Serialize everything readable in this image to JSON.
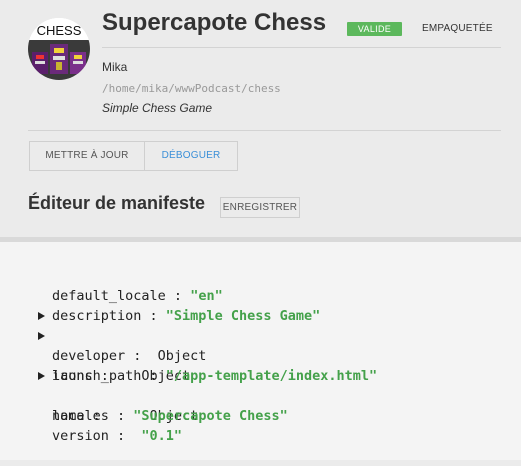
{
  "app": {
    "title": "Supercapote Chess",
    "status_valid": "VALIDE",
    "status_packaged": "EMPAQUETÉE",
    "author": "Mika",
    "path": "/home/mika/wwwPodcast/chess",
    "description": "Simple Chess Game",
    "icon_text": "CHESS"
  },
  "tabs": {
    "update_label": "METTRE À JOUR",
    "debug_label": "DÉBOGUER"
  },
  "manifest": {
    "section_title": "Éditeur de manifeste",
    "save_label": "ENREGISTRER",
    "entries": [
      {
        "key": "default_locale",
        "value": "\"en\"",
        "type": "string",
        "expandable": false
      },
      {
        "key": "description",
        "value": "\"Simple Chess Game\"",
        "type": "string",
        "expandable": false
      },
      {
        "key": "developer",
        "value": "Object",
        "type": "object",
        "expandable": true
      },
      {
        "key": "icons",
        "value": "Object",
        "type": "object",
        "expandable": true
      },
      {
        "key": "launch_path",
        "value": "\"/app-template/index.html\"",
        "type": "string",
        "expandable": false
      },
      {
        "key": "locales",
        "value": "Object",
        "type": "object",
        "expandable": true
      },
      {
        "key": "name",
        "value": "\"Supercapote Chess\"",
        "type": "string",
        "expandable": false
      },
      {
        "key": "version",
        "value": "\"0.1\"",
        "type": "string",
        "expandable": false
      }
    ]
  },
  "colors": {
    "valid_badge": "#5cb85c",
    "debug_link": "#3a8fd8",
    "string_value": "#44a14a"
  }
}
